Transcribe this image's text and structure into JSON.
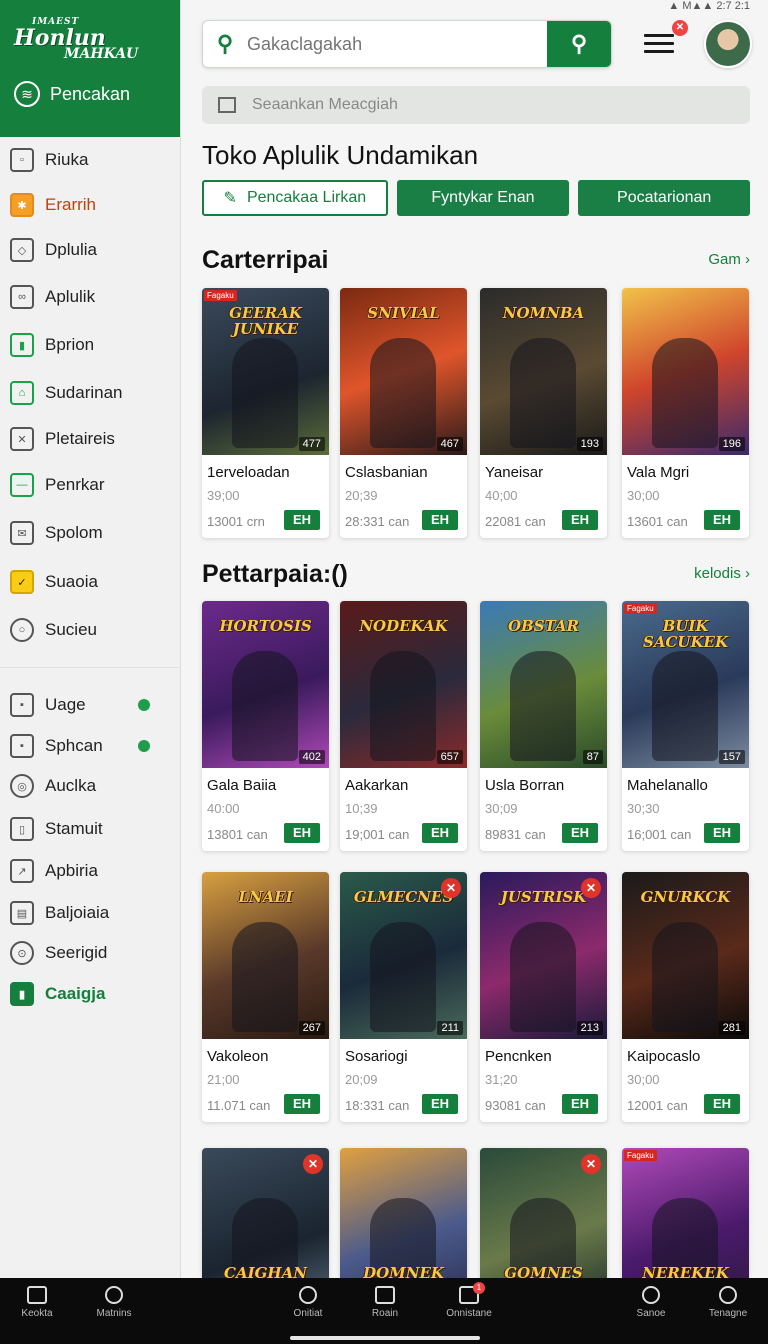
{
  "status": {
    "text": "▲ M▲▲ 2:7 2:1"
  },
  "sidebar": {
    "logo": {
      "l1": "IMAEST",
      "l2": "Honlun",
      "l3": "MAHKAU"
    },
    "active": "Pencakan",
    "items": [
      {
        "label": "Riuka",
        "icon": "photo-icon"
      },
      {
        "label": "Erarrih",
        "icon": "gift-icon"
      },
      {
        "label": "Dplulia",
        "icon": "tag-icon"
      },
      {
        "label": "Aplulik",
        "icon": "link-icon"
      },
      {
        "label": "Bprion",
        "icon": "chart-icon"
      },
      {
        "label": "Sudarinan",
        "icon": "store-icon"
      },
      {
        "label": "Pletaireis",
        "icon": "close-box-icon"
      },
      {
        "label": "Penrkar",
        "icon": "minus-box-icon"
      },
      {
        "label": "Spolom",
        "icon": "mail-icon"
      },
      {
        "label": "Suaoia",
        "icon": "check-box-icon"
      },
      {
        "label": "Sucieu",
        "icon": "search-icon"
      },
      {
        "label": "Uage",
        "icon": "image-icon",
        "dot": true
      },
      {
        "label": "Sphcan",
        "icon": "image-icon",
        "dot": true
      },
      {
        "label": "Auclka",
        "icon": "target-icon"
      },
      {
        "label": "Stamuit",
        "icon": "door-icon"
      },
      {
        "label": "Apbiria",
        "icon": "exit-icon"
      },
      {
        "label": "Baljoiaia",
        "icon": "printer-icon"
      },
      {
        "label": "Seerigid",
        "icon": "settings-icon"
      },
      {
        "label": "Caaigja",
        "icon": "book-icon"
      }
    ]
  },
  "header": {
    "search_placeholder": "Gakaclagakah",
    "notification_count": "✕",
    "banner_text": "Seaankan Meacgiah"
  },
  "page": {
    "title": "Toko Aplulik Undamikan",
    "tabs": [
      "Pencakaa Lirkan",
      "Fyntykar Enan",
      "Pocatarionan"
    ]
  },
  "section1": {
    "title": "Carterripai",
    "link": "Gam"
  },
  "section2": {
    "title": "Pettarpaia:()",
    "link": "kelodis"
  },
  "cards": [
    {
      "name": "1erveloadan",
      "sub": "39;00",
      "views": "13001 crn",
      "badge": "EH",
      "count": "477",
      "art_title": "GEERAK JUNIKE",
      "tag": "Fagaku"
    },
    {
      "name": "Cslasbanian",
      "sub": "20;39",
      "views": "28:331 can",
      "badge": "EH",
      "count": "467",
      "art_title": "SNIVIAL"
    },
    {
      "name": "Yaneisar",
      "sub": "40;00",
      "views": "22081 can",
      "badge": "EH",
      "count": "193",
      "art_title": "NOMNBA"
    },
    {
      "name": "Vala Mgri",
      "sub": "30;00",
      "views": "13601 can",
      "badge": "EH",
      "count": "196",
      "art_title": ""
    },
    {
      "name": "Gala Baiia",
      "sub": "40:00",
      "views": "13801 can",
      "badge": "EH",
      "count": "402",
      "art_title": "HORTOSIS"
    },
    {
      "name": "Aakarkan",
      "sub": "10;39",
      "views": "19;001 can",
      "badge": "EH",
      "count": "657",
      "art_title": "NODEKAK"
    },
    {
      "name": "Usla Borran",
      "sub": "30;09",
      "views": "89831 can",
      "badge": "EH",
      "count": "87",
      "art_title": "OBSTAR"
    },
    {
      "name": "Mahelanallo",
      "sub": "30;30",
      "views": "16;001 can",
      "badge": "EH",
      "count": "157",
      "art_title": "BUIK SACUKEK",
      "tag": "Fagaku"
    },
    {
      "name": "Vakoleon",
      "sub": "21;00",
      "views": "11.071 can",
      "badge": "EH",
      "count": "267",
      "art_title": "LNAEI"
    },
    {
      "name": "Sosariogi",
      "sub": "20;09",
      "views": "18:331 can",
      "badge": "EH",
      "count": "211",
      "art_title": "GLMECNES",
      "close": true
    },
    {
      "name": "Pencnken",
      "sub": "31;20",
      "views": "93081 can",
      "badge": "EH",
      "count": "213",
      "art_title": "JUSTRISK",
      "close": true
    },
    {
      "name": "Kaipocaslo",
      "sub": "30;00",
      "views": "12001 can",
      "badge": "EH",
      "count": "281",
      "art_title": "GNURKCK"
    },
    {
      "name": "",
      "sub": "",
      "views": "",
      "badge": "",
      "count": "",
      "art_title": "CAIGHAN",
      "close": true
    },
    {
      "name": "",
      "sub": "",
      "views": "",
      "badge": "",
      "count": "",
      "art_title": "DOMNEK"
    },
    {
      "name": "",
      "sub": "",
      "views": "",
      "badge": "",
      "count": "",
      "art_title": "GOMNES",
      "close": true
    },
    {
      "name": "",
      "sub": "",
      "views": "",
      "badge": "",
      "count": "",
      "art_title": "NEREKEK",
      "tag": "Fagaku"
    }
  ],
  "bottom_nav": [
    {
      "label": "Keokta",
      "icon": "home-icon"
    },
    {
      "label": "Matnins",
      "icon": "person-icon"
    },
    {
      "label": "Onitiat",
      "icon": "search-icon"
    },
    {
      "label": "Roain",
      "icon": "camera-icon"
    },
    {
      "label": "Onnistane",
      "icon": "inbox-icon",
      "badge": "1"
    },
    {
      "label": "Sanoe",
      "icon": "search-icon"
    },
    {
      "label": "Tenagne",
      "icon": "search-icon"
    }
  ],
  "colors": {
    "brand": "#15803d",
    "sidebar_bg": "#f0f1f0",
    "accent_red": "#e0342b"
  }
}
